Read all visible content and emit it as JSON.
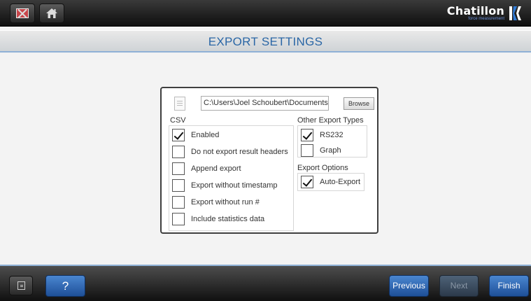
{
  "header": {
    "exit_icon": "exit-icon",
    "home_icon": "home-icon",
    "logo_text": "Chatillon",
    "logo_subtext": "force measurement"
  },
  "page_title": "EXPORT SETTINGS",
  "export_path": {
    "value": "C:\\Users\\Joel Schoubert\\Documents\\CS",
    "browse_label": "Browse"
  },
  "csv": {
    "label": "CSV",
    "options": [
      {
        "label": "Enabled",
        "checked": true
      },
      {
        "label": "Do not export result headers",
        "checked": false
      },
      {
        "label": "Append export",
        "checked": false
      },
      {
        "label": "Export without timestamp",
        "checked": false
      },
      {
        "label": "Export without run #",
        "checked": false
      },
      {
        "label": "Include statistics data",
        "checked": false
      }
    ]
  },
  "other_export_types": {
    "label": "Other Export Types",
    "options": [
      {
        "label": "RS232",
        "checked": true
      },
      {
        "label": "Graph",
        "checked": false
      }
    ]
  },
  "export_options": {
    "label": "Export Options",
    "options": [
      {
        "label": "Auto-Export",
        "checked": true
      }
    ]
  },
  "footer": {
    "help_label": "?",
    "previous_label": "Previous",
    "next_label": "Next",
    "finish_label": "Finish"
  },
  "colors": {
    "accent_blue": "#2b67a6",
    "button_blue": "#3a72bd",
    "disabled_button": "#3c4b5d"
  }
}
